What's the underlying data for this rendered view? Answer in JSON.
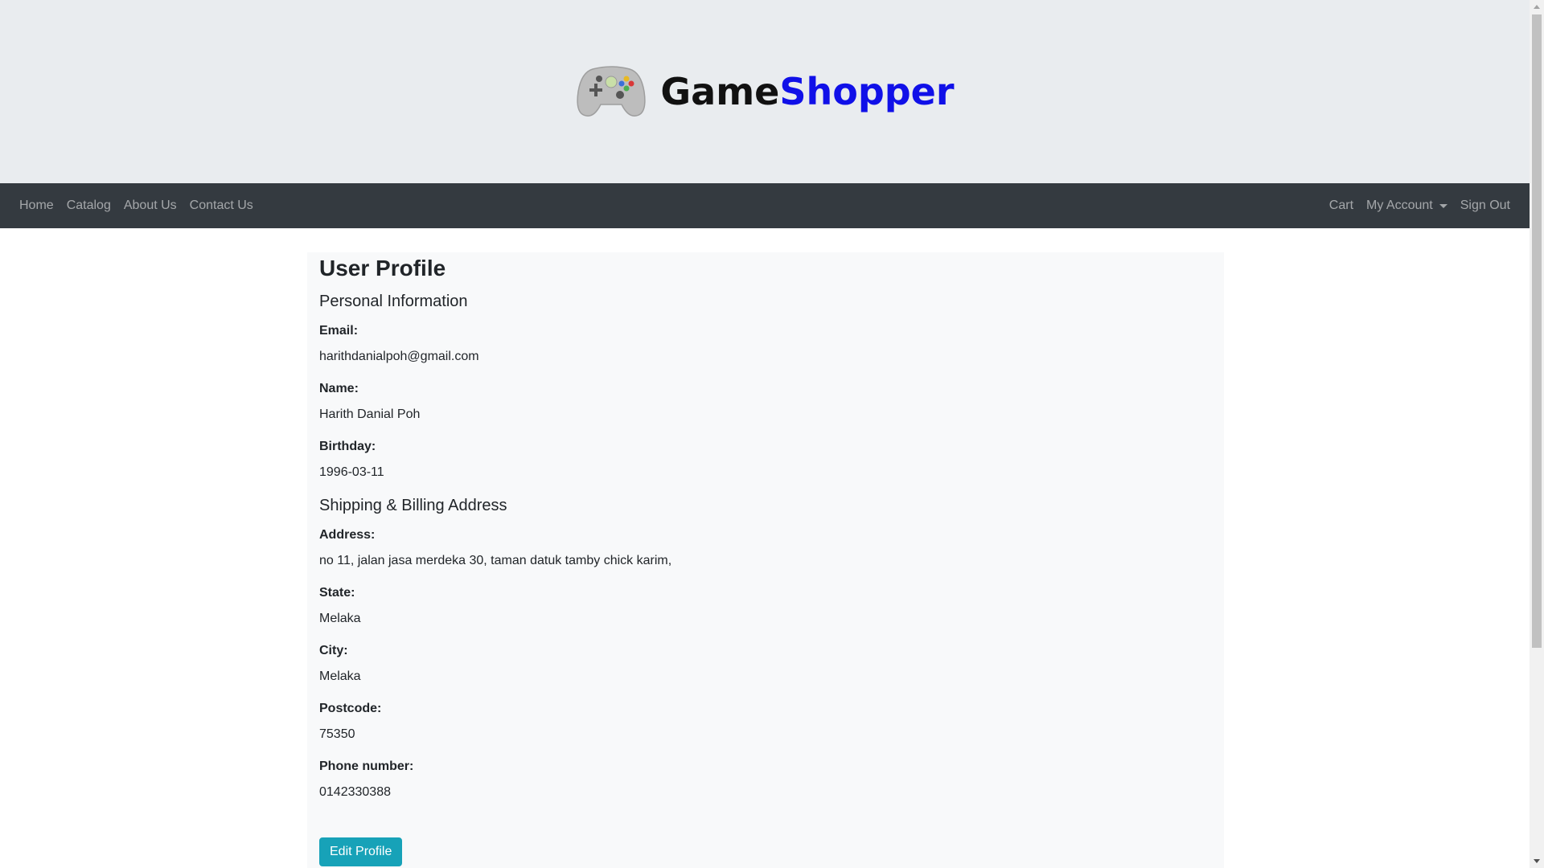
{
  "brand": {
    "name_part1": "Game",
    "name_part2": "Shopper",
    "logo_icon": "gamepad-icon",
    "colors": {
      "part1": "#111111",
      "part2": "#1010e8"
    }
  },
  "navbar": {
    "left": [
      "Home",
      "Catalog",
      "About Us",
      "Contact Us"
    ],
    "cart": "Cart",
    "account": "My Account",
    "signout": "Sign Out"
  },
  "profile": {
    "title": "User Profile",
    "personal_heading": "Personal Information",
    "email_label": "Email:",
    "email": "harithdanialpoh@gmail.com",
    "name_label": "Name:",
    "name": "Harith Danial Poh",
    "birthday_label": "Birthday:",
    "birthday": "1996-03-11",
    "address_heading": "Shipping & Billing Address",
    "address_label": "Address:",
    "address": "no 11, jalan jasa merdeka 30, taman datuk tamby chick karim,",
    "state_label": "State:",
    "state": "Melaka",
    "city_label": "City:",
    "city": "Melaka",
    "postcode_label": "Postcode:",
    "postcode": "75350",
    "phone_label": "Phone number:",
    "phone": "0142330388",
    "edit_button": "Edit Profile"
  },
  "colors": {
    "banner_bg": "#e9ecef",
    "navbar_bg": "#343a40",
    "card_bg": "#f8f9fa",
    "button_bg": "#17a2b8"
  }
}
